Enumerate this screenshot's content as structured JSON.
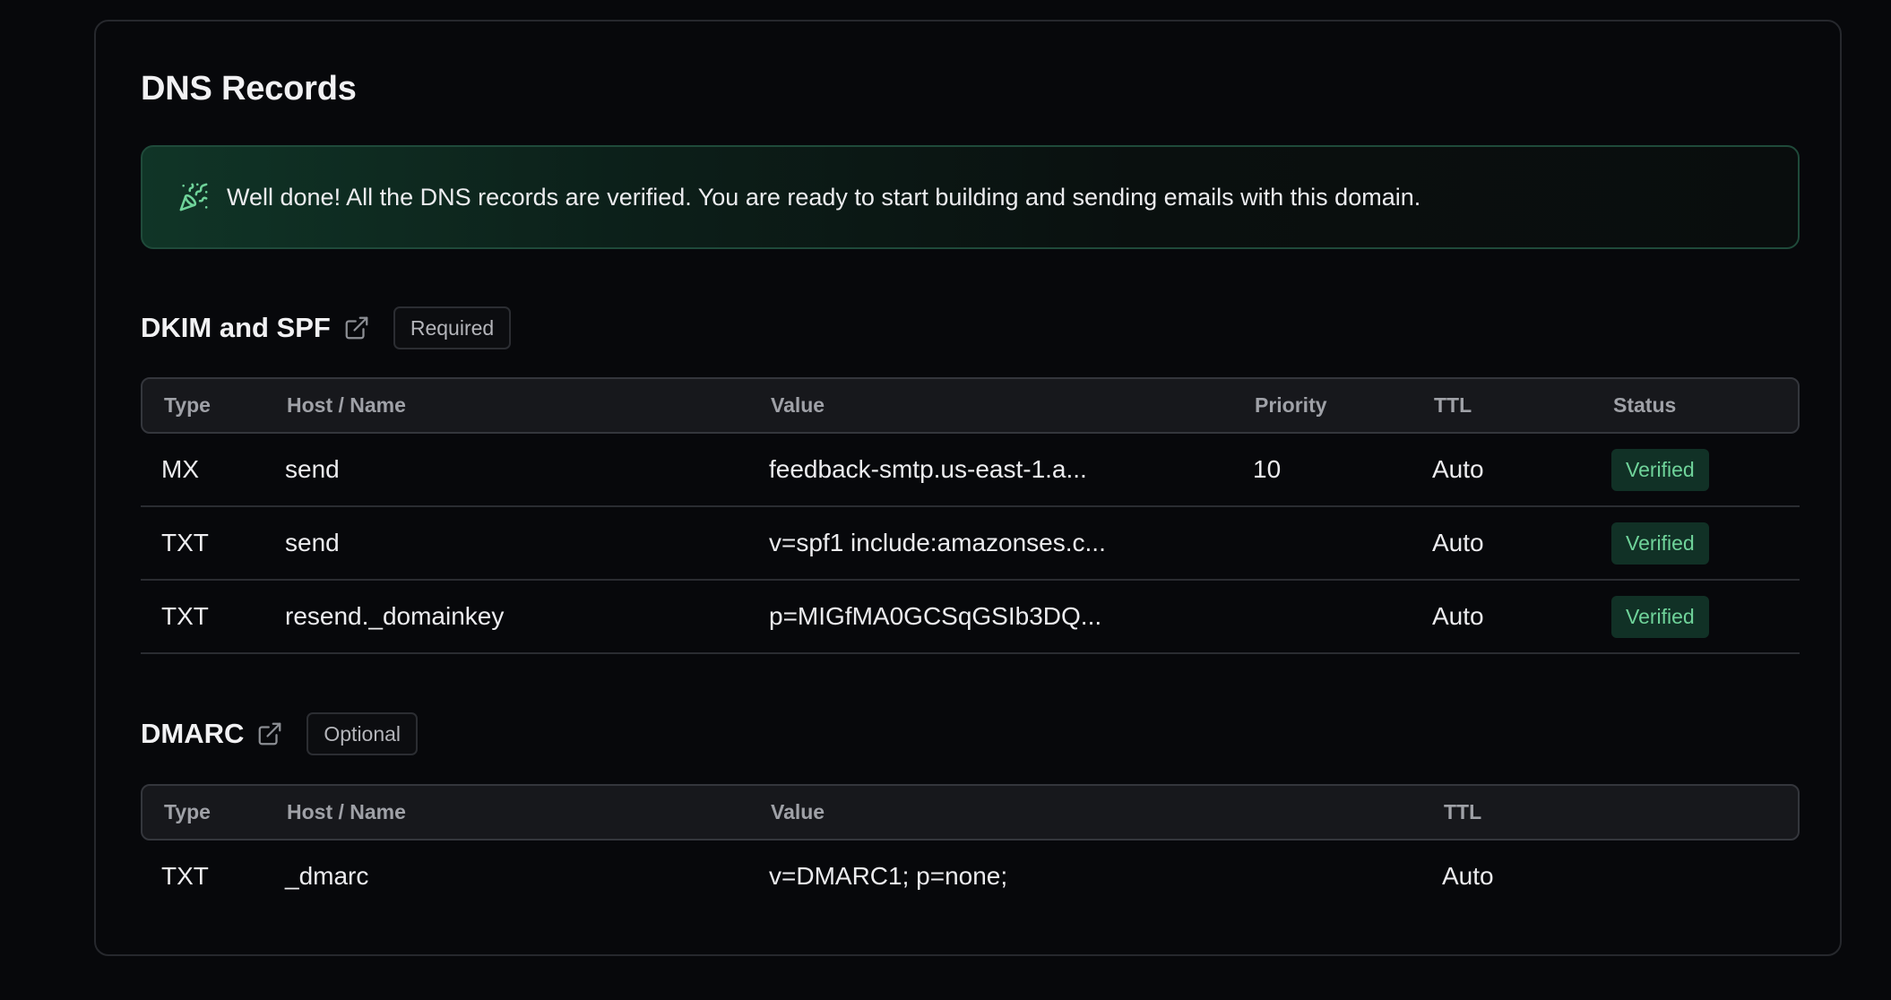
{
  "page": {
    "title": "DNS Records"
  },
  "banner": {
    "icon": "party-popper-icon",
    "message": "Well done! All the DNS records are verified. You are ready to start building and sending emails with this domain."
  },
  "colors": {
    "accent_green": "#6fd39a",
    "background": "#07080b",
    "banner_border": "#1f4a3a",
    "verified_bg": "#113126"
  },
  "dkim_spf": {
    "title": "DKIM and SPF",
    "link_icon": "external-link-icon",
    "badge": "Required",
    "columns": [
      "Type",
      "Host / Name",
      "Value",
      "Priority",
      "TTL",
      "Status"
    ],
    "rows": [
      {
        "type": "MX",
        "host": "send",
        "value": "feedback-smtp.us-east-1.a...",
        "priority": "10",
        "ttl": "Auto",
        "status": "Verified"
      },
      {
        "type": "TXT",
        "host": "send",
        "value": "v=spf1 include:amazonses.c...",
        "priority": "",
        "ttl": "Auto",
        "status": "Verified"
      },
      {
        "type": "TXT",
        "host": "resend._domainkey",
        "value": "p=MIGfMA0GCSqGSIb3DQ...",
        "priority": "",
        "ttl": "Auto",
        "status": "Verified"
      }
    ]
  },
  "dmarc": {
    "title": "DMARC",
    "link_icon": "external-link-icon",
    "badge": "Optional",
    "columns": [
      "Type",
      "Host / Name",
      "Value",
      "TTL"
    ],
    "rows": [
      {
        "type": "TXT",
        "host": "_dmarc",
        "value": "v=DMARC1; p=none;",
        "ttl": "Auto"
      }
    ]
  }
}
